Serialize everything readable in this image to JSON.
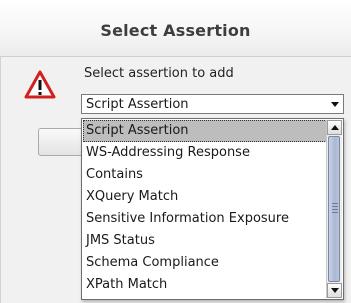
{
  "dialog": {
    "title": "Select Assertion",
    "prompt": "Select assertion to add",
    "icon": "warning-icon"
  },
  "assertion_select": {
    "value": "Script Assertion",
    "options": [
      "Script Assertion",
      "WS-Addressing Response",
      "Contains",
      "XQuery Match",
      "Sensitive Information Exposure",
      "JMS Status",
      "Schema Compliance",
      "XPath Match"
    ],
    "selected_index": 0
  },
  "colors": {
    "warning_red": "#d21f1f",
    "selection": "#bdbdbd",
    "scroll_thumb": "#a9b8d4"
  }
}
